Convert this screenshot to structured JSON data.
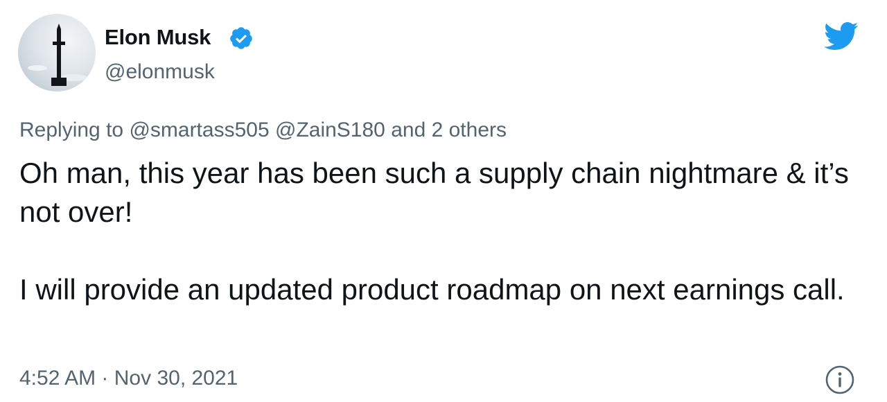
{
  "tweet": {
    "author_name": "Elon Musk",
    "handle": "@elonmusk",
    "reply": {
      "prefix": "Replying to",
      "mention_1": "@smartass505",
      "mention_2": "@ZainS180",
      "suffix": "and 2 others"
    },
    "body": {
      "paragraph_1": "Oh man, this year has been such a supply chain nightmare & it’s not over!",
      "paragraph_2": "I will provide an updated product roadmap on next earnings call."
    },
    "time": "4:52 AM",
    "separator": "·",
    "date": "Nov 30, 2021"
  },
  "icons": {
    "verified": "verified-badge-icon",
    "brand": "twitter-bird-icon",
    "info": "info-icon"
  },
  "colors": {
    "text_primary": "#0f1419",
    "text_secondary": "#536471",
    "brand_blue": "#1d9bf0"
  }
}
